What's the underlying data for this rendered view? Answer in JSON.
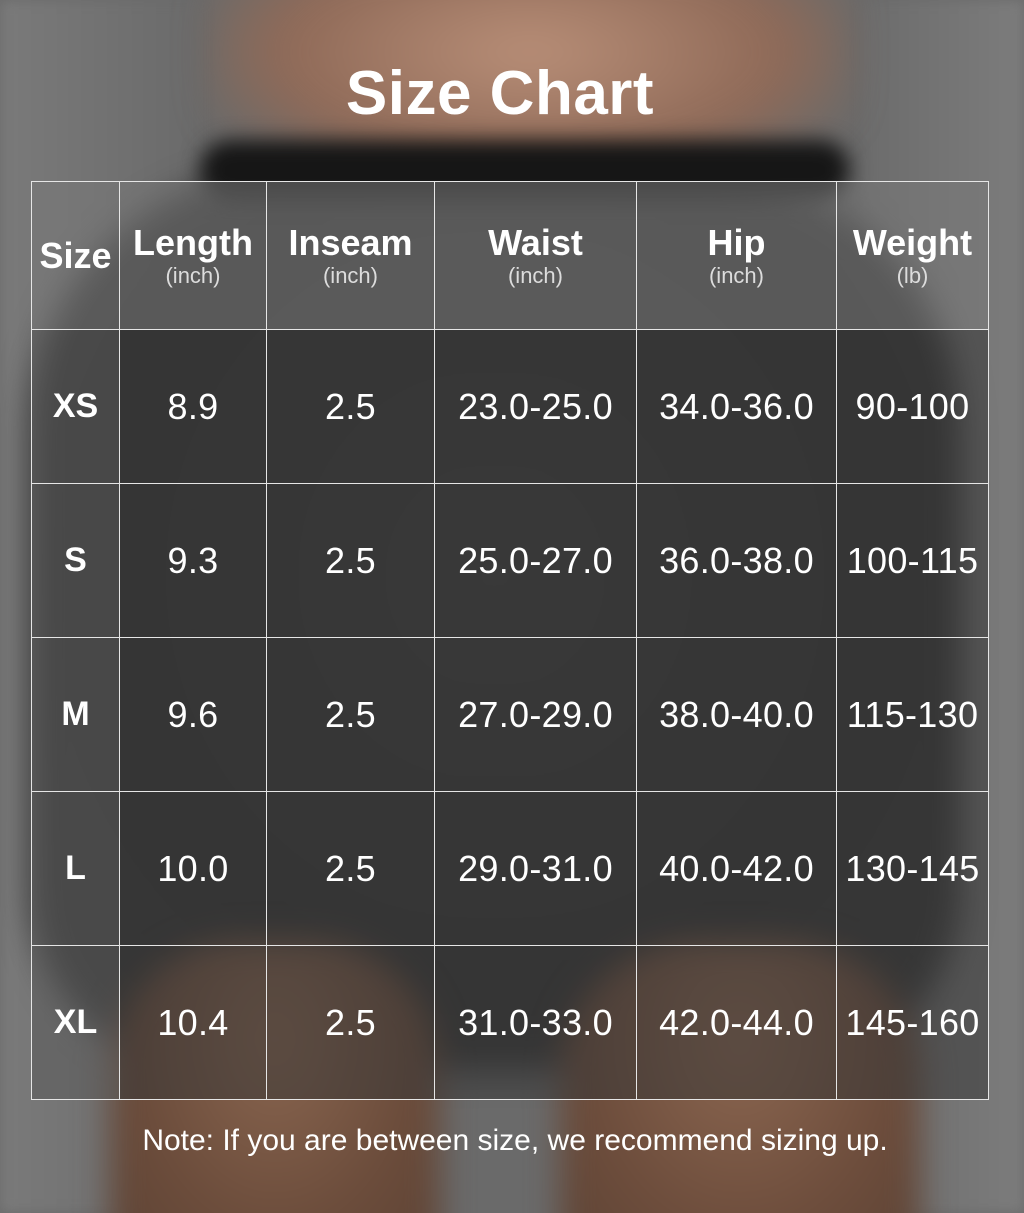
{
  "title": "Size Chart",
  "headers": [
    {
      "name": "Size",
      "unit": ""
    },
    {
      "name": "Length",
      "unit": "(inch)"
    },
    {
      "name": "Inseam",
      "unit": "(inch)"
    },
    {
      "name": "Waist",
      "unit": "(inch)"
    },
    {
      "name": "Hip",
      "unit": "(inch)"
    },
    {
      "name": "Weight",
      "unit": "(lb)"
    }
  ],
  "rows": [
    [
      "XS",
      "8.9",
      "2.5",
      "23.0-25.0",
      "34.0-36.0",
      "90-100"
    ],
    [
      "S",
      "9.3",
      "2.5",
      "25.0-27.0",
      "36.0-38.0",
      "100-115"
    ],
    [
      "M",
      "9.6",
      "2.5",
      "27.0-29.0",
      "38.0-40.0",
      "115-130"
    ],
    [
      "L",
      "10.0",
      "2.5",
      "29.0-31.0",
      "40.0-42.0",
      "130-145"
    ],
    [
      "XL",
      "10.4",
      "2.5",
      "31.0-33.0",
      "42.0-44.0",
      "145-160"
    ]
  ],
  "note": "Note: If you are between size, we recommend sizing up."
}
